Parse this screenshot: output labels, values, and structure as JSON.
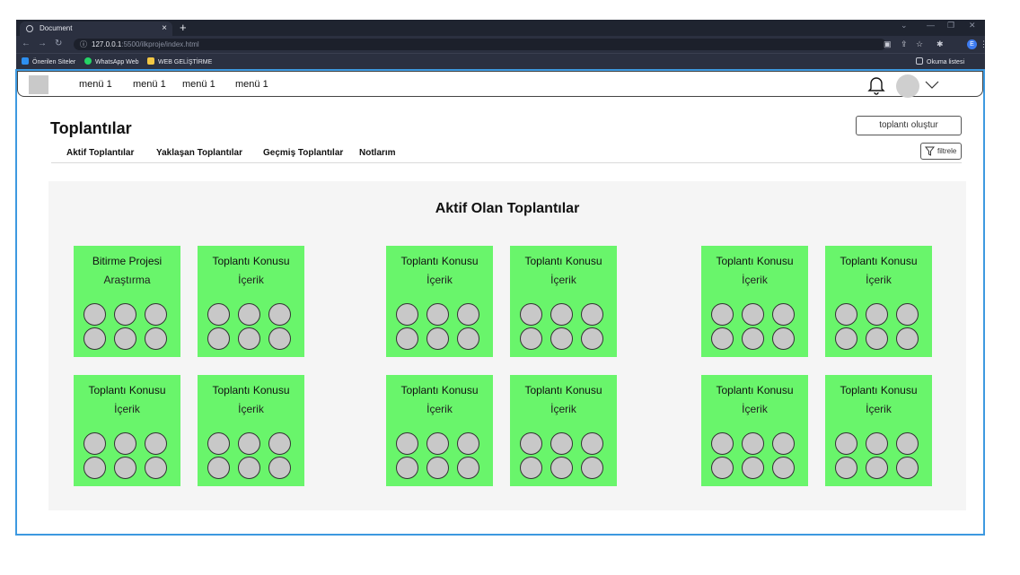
{
  "browser": {
    "tab_title": "Document",
    "tab_close": "×",
    "new_tab": "+",
    "url_host": "127.0.0.1",
    "url_rest": ":5500/ilkproje/index.html",
    "profile_initial": "E",
    "bookmarks": [
      "Önerilen Siteler",
      "WhatsApp Web",
      "WEB GELİŞTİRME"
    ],
    "reading_list": "Okuma listesi"
  },
  "navbar": {
    "menu": [
      "menü 1",
      "menü 1",
      "menü 1",
      "menü 1"
    ]
  },
  "header": {
    "title": "Toplantılar",
    "create_button": "toplantı oluştur",
    "filter_button": "filtrele"
  },
  "tabs": [
    "Aktif Toplantılar",
    "Yaklaşan Toplantılar",
    "Geçmiş Toplantılar",
    "Notlarım"
  ],
  "panel": {
    "title": "Aktif Olan Toplantılar"
  },
  "cards": [
    {
      "title": "Bitirme Projesi",
      "subtitle": "Araştırma"
    },
    {
      "title": "Toplantı Konusu",
      "subtitle": "İçerik"
    },
    {
      "title": "Toplantı Konusu",
      "subtitle": "İçerik"
    },
    {
      "title": "Toplantı Konusu",
      "subtitle": "İçerik"
    },
    {
      "title": "Toplantı Konusu",
      "subtitle": "İçerik"
    },
    {
      "title": "Toplantı Konusu",
      "subtitle": "İçerik"
    },
    {
      "title": "Toplantı Konusu",
      "subtitle": "İçerik"
    },
    {
      "title": "Toplantı Konusu",
      "subtitle": "İçerik"
    },
    {
      "title": "Toplantı Konusu",
      "subtitle": "İçerik"
    },
    {
      "title": "Toplantı Konusu",
      "subtitle": "İçerik"
    },
    {
      "title": "Toplantı Konusu",
      "subtitle": "İçerik"
    },
    {
      "title": "Toplantı Konusu",
      "subtitle": "İçerik"
    }
  ],
  "colors": {
    "card": "#69f56b",
    "participant": "#c8c8c8",
    "frame": "#3d99e0"
  },
  "icons": {
    "notifications": "bell-icon",
    "menu": "chevron-down-icon",
    "filter": "filter-icon"
  }
}
